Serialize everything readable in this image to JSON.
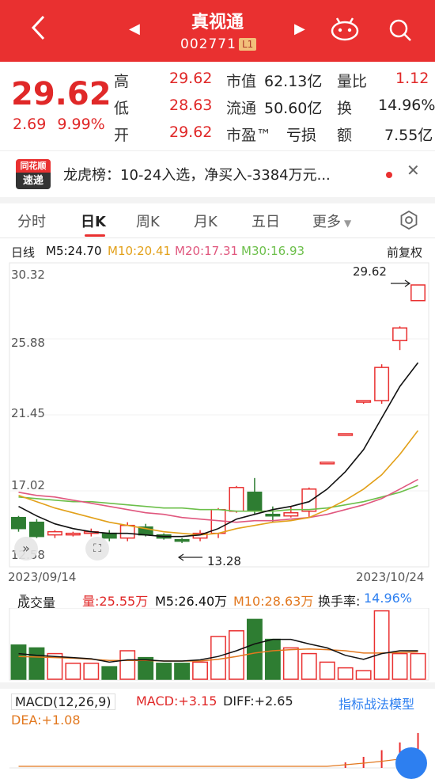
{
  "header": {
    "title": "真视通",
    "code": "002771",
    "badge": "L1",
    "back_icon": "chevron-left-icon",
    "prev_icon": "triangle-left-icon",
    "next_icon": "triangle-right-icon"
  },
  "quote": {
    "price": "29.62",
    "change": "2.69",
    "change_pct": "9.99%",
    "rows": [
      {
        "l1": "高",
        "v1": "29.62",
        "l2": "市值",
        "v2": "62.13亿",
        "l3": "量比",
        "v3": "1.12"
      },
      {
        "l1": "低",
        "v1": "28.63",
        "l2": "流通",
        "v2": "50.60亿",
        "l3": "换",
        "v3": "14.96%"
      },
      {
        "l1": "开",
        "v1": "29.62",
        "l2": "市盈™",
        "v2": "亏损",
        "l3": "额",
        "v3": "7.55亿"
      }
    ]
  },
  "news": {
    "logo_top": "同花顺",
    "logo_bottom": "速递",
    "text": "龙虎榜：10-24入选，净买入-3384万元..."
  },
  "tabs": [
    "分时",
    "日K",
    "周K",
    "月K",
    "五日",
    "更多"
  ],
  "ma_legend": {
    "label": "日线",
    "m5": "M5:24.70",
    "m10": "M10:20.41",
    "m20": "M20:17.31",
    "m30": "M30:16.93",
    "adjust": "前复权"
  },
  "colors": {
    "red": "#e93030",
    "green": "#2e7d32",
    "m5": "#111111",
    "m10": "#e2a019",
    "m20": "#e0577e",
    "m30": "#6cbf4a",
    "blue": "#2d7ff0"
  },
  "kchart": {
    "y_labels": [
      "30.32",
      "25.88",
      "21.45",
      "17.02",
      "12.58"
    ],
    "high_label": "29.62",
    "low_label": "13.28",
    "start_date": "2023/09/14",
    "end_date": "2023/10/24"
  },
  "chart_data": {
    "type": "candlestick",
    "ylim": [
      12.58,
      30.32
    ],
    "candles": [
      {
        "o": 14.9,
        "c": 14.2,
        "h": 15.0,
        "l": 14.0
      },
      {
        "o": 14.6,
        "c": 13.7,
        "h": 14.8,
        "l": 13.6
      },
      {
        "o": 13.8,
        "c": 14.0,
        "h": 14.1,
        "l": 13.6
      },
      {
        "o": 13.8,
        "c": 13.9,
        "h": 14.0,
        "l": 13.7
      },
      {
        "o": 13.9,
        "c": 14.0,
        "h": 14.2,
        "l": 13.7
      },
      {
        "o": 13.9,
        "c": 13.6,
        "h": 14.1,
        "l": 13.4
      },
      {
        "o": 13.6,
        "c": 14.4,
        "h": 14.6,
        "l": 13.4
      },
      {
        "o": 14.3,
        "c": 13.8,
        "h": 14.5,
        "l": 13.7
      },
      {
        "o": 13.8,
        "c": 13.6,
        "h": 13.9,
        "l": 13.5
      },
      {
        "o": 13.5,
        "c": 13.4,
        "h": 13.6,
        "l": 13.28
      },
      {
        "o": 13.6,
        "c": 13.9,
        "h": 14.1,
        "l": 13.4
      },
      {
        "o": 13.9,
        "c": 15.4,
        "h": 15.5,
        "l": 13.6
      },
      {
        "o": 15.3,
        "c": 16.8,
        "h": 16.9,
        "l": 15.2
      },
      {
        "o": 16.5,
        "c": 15.3,
        "h": 17.4,
        "l": 15.1
      },
      {
        "o": 15.1,
        "c": 15.0,
        "h": 15.6,
        "l": 14.6
      },
      {
        "o": 15.0,
        "c": 15.2,
        "h": 15.6,
        "l": 14.9
      },
      {
        "o": 15.3,
        "c": 16.7,
        "h": 16.8,
        "l": 14.9
      },
      {
        "o": 18.4,
        "c": 18.4,
        "h": 18.4,
        "l": 18.4
      },
      {
        "o": 20.2,
        "c": 20.2,
        "h": 20.2,
        "l": 20.2
      },
      {
        "o": 22.2,
        "c": 22.3,
        "h": 22.3,
        "l": 22.1
      },
      {
        "o": 22.3,
        "c": 24.4,
        "h": 24.6,
        "l": 22.1
      },
      {
        "o": 26.1,
        "c": 26.9,
        "h": 27.0,
        "l": 25.5
      },
      {
        "o": 28.63,
        "c": 29.62,
        "h": 29.62,
        "l": 28.63
      }
    ],
    "m5": [
      15.6,
      15.0,
      14.5,
      14.2,
      14.0,
      13.9,
      13.9,
      13.8,
      13.7,
      13.7,
      13.8,
      14.2,
      14.8,
      15.1,
      15.4,
      15.6,
      15.9,
      16.7,
      17.8,
      19.2,
      21.2,
      23.2,
      24.7
    ],
    "m10": [
      16.3,
      15.9,
      15.5,
      15.2,
      14.9,
      14.6,
      14.4,
      14.2,
      14.0,
      13.9,
      13.8,
      13.9,
      14.2,
      14.4,
      14.6,
      14.7,
      14.9,
      15.4,
      16.0,
      16.7,
      17.6,
      18.9,
      20.41
    ],
    "m20": [
      16.5,
      16.3,
      16.2,
      16.0,
      15.8,
      15.6,
      15.4,
      15.2,
      15.1,
      14.9,
      14.8,
      14.7,
      14.6,
      14.7,
      14.7,
      14.8,
      14.9,
      15.1,
      15.4,
      15.7,
      16.1,
      16.7,
      17.31
    ],
    "m30": [
      16.2,
      16.1,
      16.0,
      15.9,
      15.9,
      15.8,
      15.7,
      15.6,
      15.5,
      15.5,
      15.4,
      15.4,
      15.3,
      15.3,
      15.3,
      15.4,
      15.4,
      15.5,
      15.7,
      15.9,
      16.2,
      16.5,
      16.93
    ],
    "volumes": [
      0.6,
      0.55,
      0.45,
      0.28,
      0.28,
      0.22,
      0.5,
      0.38,
      0.28,
      0.28,
      0.3,
      0.75,
      0.85,
      1.05,
      0.7,
      0.55,
      0.45,
      0.3,
      0.2,
      0.15,
      1.2,
      0.45,
      0.45
    ],
    "vol_ma5": [
      0.45,
      0.42,
      0.4,
      0.38,
      0.36,
      0.3,
      0.34,
      0.34,
      0.32,
      0.32,
      0.34,
      0.4,
      0.5,
      0.62,
      0.7,
      0.7,
      0.62,
      0.55,
      0.42,
      0.35,
      0.45,
      0.5,
      0.5
    ],
    "vol_ma10": [
      0.4,
      0.39,
      0.38,
      0.37,
      0.35,
      0.33,
      0.33,
      0.33,
      0.32,
      0.32,
      0.32,
      0.35,
      0.4,
      0.46,
      0.5,
      0.52,
      0.53,
      0.52,
      0.5,
      0.46,
      0.46,
      0.47,
      0.48
    ],
    "macd": [
      0,
      0,
      0,
      0,
      0,
      0,
      0,
      0,
      0,
      0,
      0,
      0,
      0,
      0,
      0,
      0,
      0,
      0,
      0.5,
      1.0,
      1.6,
      2.3,
      3.15
    ]
  },
  "vol_legend": {
    "label": "成交量",
    "v": "量:25.55万",
    "m5": "M5:26.40万",
    "m10": "M10:28.63万",
    "turnover_label": "换手率:",
    "turnover": "14.96%"
  },
  "macd_legend": {
    "label": "MACD(12,26,9)",
    "macd": "MACD:+3.15",
    "diff": "DIFF:+2.65",
    "dea": "DEA:+1.08",
    "link": "指标战法模型"
  }
}
